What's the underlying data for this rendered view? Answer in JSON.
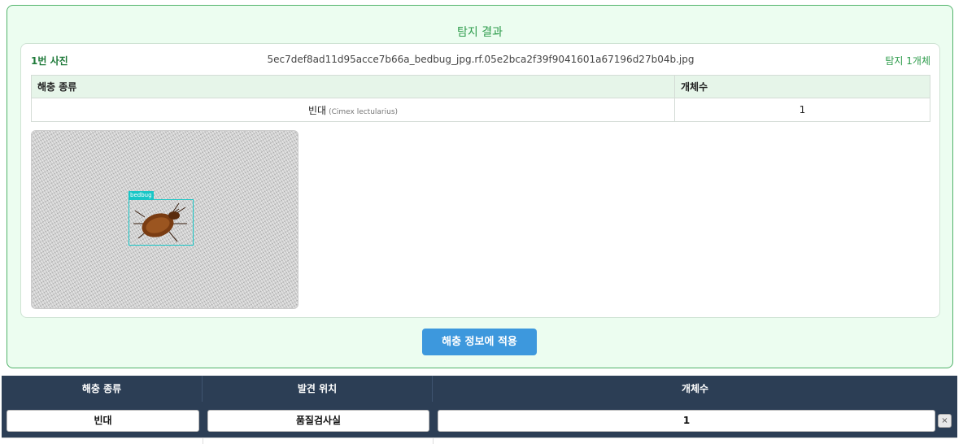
{
  "result": {
    "title": "탐지 결과",
    "photo": {
      "number_label": "1번 사진",
      "filename": "5ec7def8ad11d95acce7b66a_bedbug_jpg.rf.05e2bca2f39f9041601a67196d27b04b.jpg",
      "count_label": "탐지 1개체",
      "table": {
        "headers": [
          "해충 종류",
          "개체수"
        ],
        "rows": [
          {
            "species": "빈대",
            "scientific": "(Cimex lectularius)",
            "count": "1"
          }
        ]
      },
      "detection_label": "bedbug"
    },
    "apply_button": "해충 정보에 적용"
  },
  "pest_table": {
    "headers": [
      "해충 종류",
      "발견 위치",
      "개체수"
    ],
    "row": {
      "species": "빈대",
      "location": "품질검사실",
      "count": "1"
    },
    "remove_icon": "×"
  },
  "colors": {
    "panel_border": "#52b36b",
    "panel_bg": "#ecfdf0",
    "accent_green": "#2e9c4c",
    "button_blue": "#3d98dd",
    "table_header_dark": "#2c3e55",
    "bbox_cyan": "#19c6c6"
  }
}
